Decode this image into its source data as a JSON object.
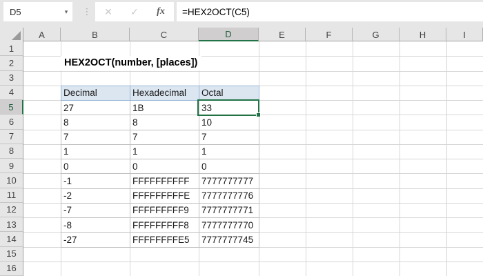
{
  "formula_bar": {
    "name_box_value": "D5",
    "dropdown_icon": "▾",
    "separator_icon": "⋮",
    "cancel_icon": "✕",
    "enter_icon": "✓",
    "fx_label": "fx",
    "formula": "=HEX2OCT(C5)"
  },
  "sheet": {
    "title": "HEX2OCT(number, [places])",
    "column_letters": [
      "A",
      "B",
      "C",
      "D",
      "E",
      "F",
      "G",
      "H",
      "I"
    ],
    "row_numbers": [
      "1",
      "2",
      "3",
      "4",
      "5",
      "6",
      "7",
      "8",
      "9",
      "10",
      "11",
      "12",
      "13",
      "14",
      "15",
      "16"
    ],
    "selected_column": "D",
    "selected_row": "5",
    "selected_cell": "D5"
  },
  "table": {
    "headers": [
      "Decimal",
      "Hexadecimal",
      "Octal"
    ],
    "rows": [
      [
        "27",
        "1B",
        "33"
      ],
      [
        "8",
        "8",
        "10"
      ],
      [
        "7",
        "7",
        "7"
      ],
      [
        "1",
        "1",
        "1"
      ],
      [
        "0",
        "0",
        "0"
      ],
      [
        "-1",
        "FFFFFFFFFF",
        "7777777777"
      ],
      [
        "-2",
        "FFFFFFFFFE",
        "7777777776"
      ],
      [
        "-7",
        "FFFFFFFFF9",
        "7777777771"
      ],
      [
        "-8",
        "FFFFFFFFF8",
        "7777777770"
      ],
      [
        "-27",
        "FFFFFFFFE5",
        "7777777745"
      ]
    ]
  },
  "colors": {
    "accent_green": "#217346",
    "table_header_fill": "#dce6f1",
    "table_header_border": "#95b3d7",
    "table_border": "#bfbfbf",
    "chrome_bg": "#e6e6e6",
    "selected_header_bg": "#d0cece",
    "gridline": "#d6d6d6"
  }
}
